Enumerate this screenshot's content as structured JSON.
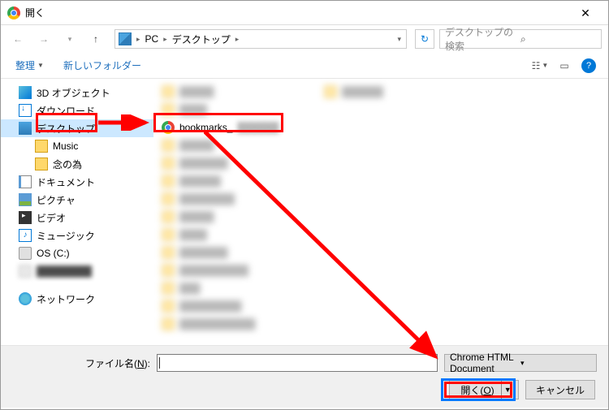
{
  "title": "開く",
  "nav": {
    "breadcrumb": [
      "PC",
      "デスクトップ"
    ],
    "search_placeholder": "デスクトップの検索"
  },
  "toolbar": {
    "organize": "整理",
    "new_folder": "新しいフォルダー"
  },
  "sidebar": {
    "items": [
      {
        "label": "3D オブジェクト",
        "icon": "3d"
      },
      {
        "label": "ダウンロード",
        "icon": "dl"
      },
      {
        "label": "デスクトップ",
        "icon": "desktop",
        "selected": true
      },
      {
        "label": "Music",
        "icon": "folder",
        "indent": true
      },
      {
        "label": "念の為",
        "icon": "folder",
        "indent": true
      },
      {
        "label": "ドキュメント",
        "icon": "doc"
      },
      {
        "label": "ピクチャ",
        "icon": "pic"
      },
      {
        "label": "ビデオ",
        "icon": "vid"
      },
      {
        "label": "ミュージック",
        "icon": "music"
      },
      {
        "label": "OS (C:)",
        "icon": "disk"
      }
    ],
    "blurred_disk": true,
    "network": "ネットワーク"
  },
  "files": {
    "highlighted": {
      "name": "bookmarks_",
      "icon": "chrome"
    },
    "blurred_count_col1": 14,
    "blurred_count_col2": 1
  },
  "bottom": {
    "filename_label": "ファイル名(N):",
    "filename_value": "",
    "filter": "Chrome HTML Document",
    "open_btn": "開く(O)",
    "cancel_btn": "キャンセル"
  },
  "highlights": {
    "colors": {
      "red": "#ff0000",
      "blue": "#0078ff"
    }
  }
}
